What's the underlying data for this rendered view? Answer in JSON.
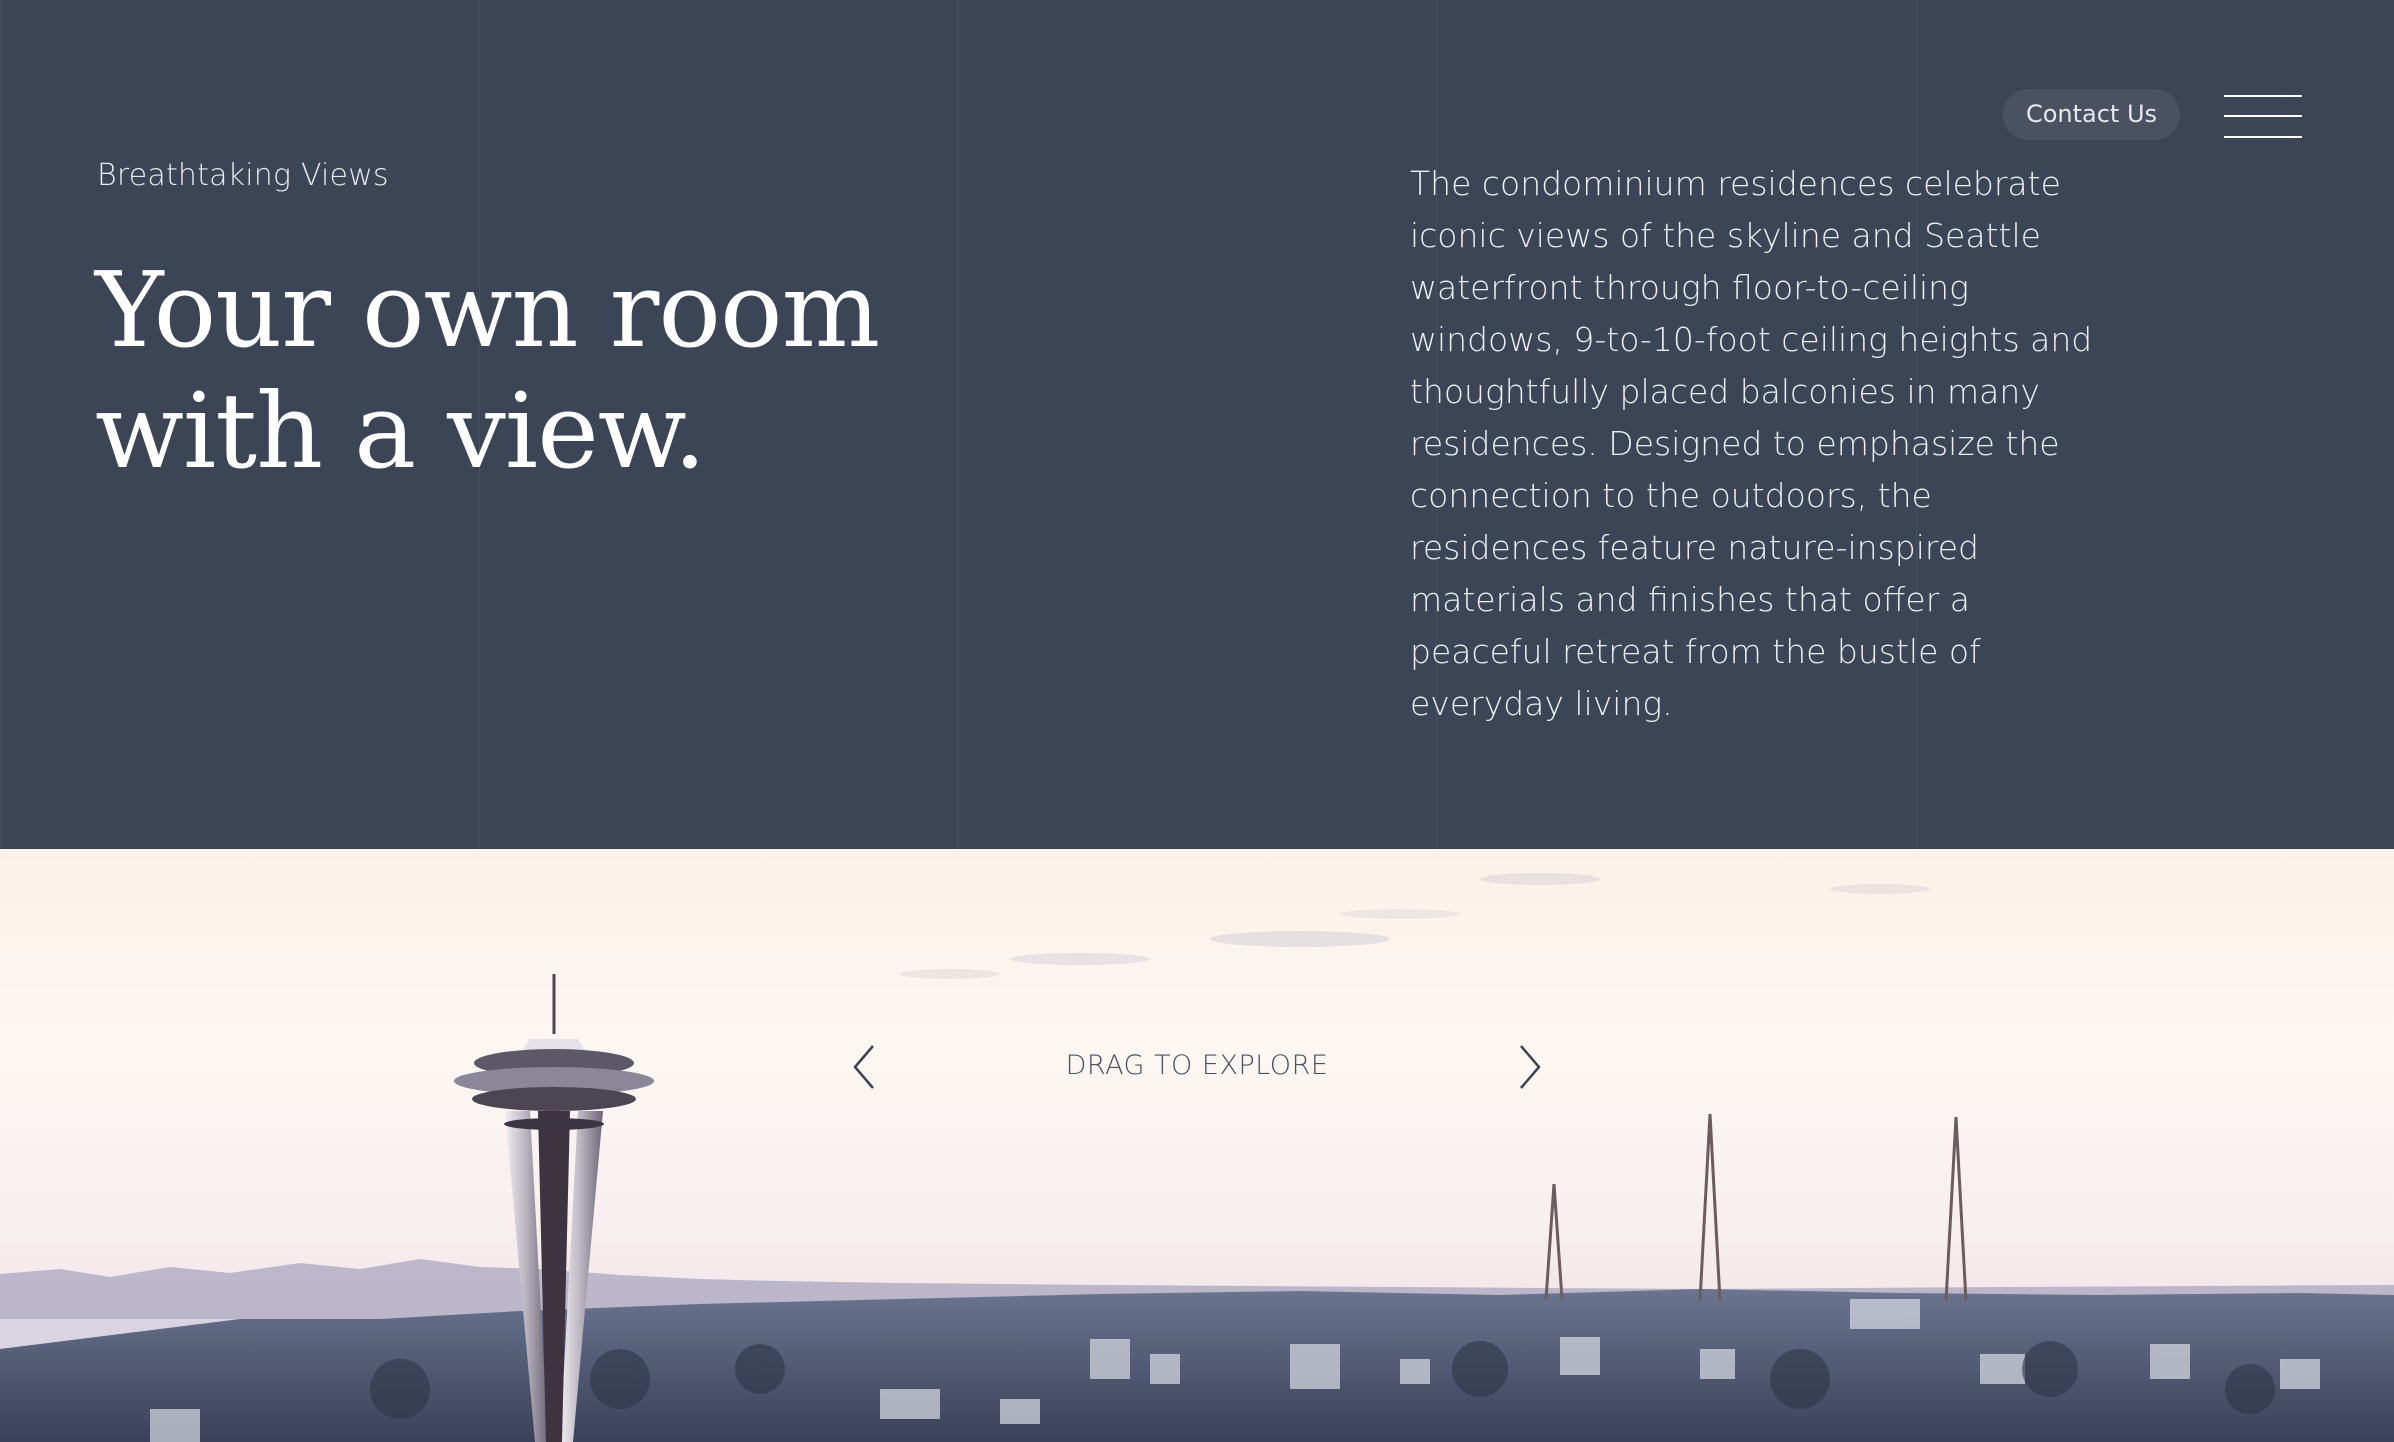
{
  "header": {
    "contact_label": "Contact Us",
    "menu_icon": "hamburger-menu-icon"
  },
  "intro": {
    "eyebrow": "Breathtaking Views",
    "headline_line1": "Your own room",
    "headline_line2": "with a view.",
    "body": "The condominium residences celebrate iconic views of the skyline and Seattle waterfront through floor-to-ceiling windows, 9-to-10-foot ceiling heights and thoughtfully placed balconies in many residences. Designed to emphasize the connection to the outdoors, the residences feature nature-inspired materials and finishes that offer a peaceful retreat from the bustle of everyday living."
  },
  "panorama": {
    "drag_label": "DRAG TO EXPLORE",
    "prev_icon": "chevron-left-icon",
    "next_icon": "chevron-right-icon"
  },
  "colors": {
    "panel_bg": "#3b4556",
    "text_light": "#ffffff",
    "button_bg": "#4a5262",
    "drag_text": "#4a4f5a"
  }
}
